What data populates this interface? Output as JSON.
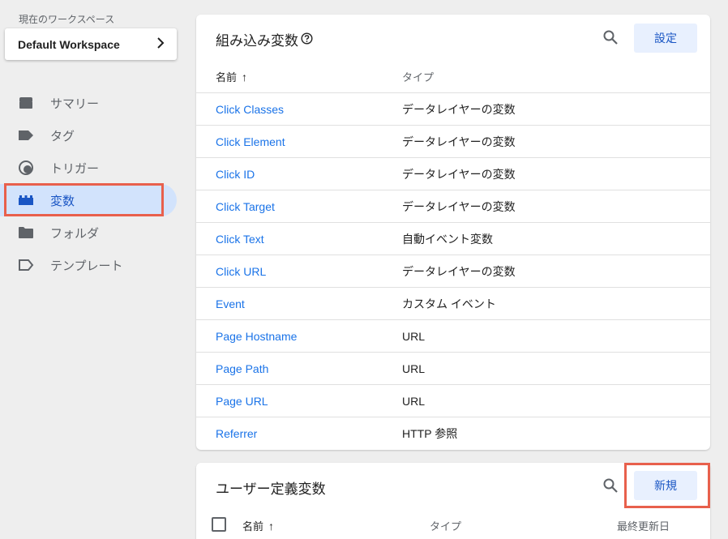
{
  "workspace": {
    "label": "現在のワークスペース",
    "name": "Default Workspace"
  },
  "nav": {
    "items": [
      {
        "label": "サマリー",
        "icon": "summary-icon"
      },
      {
        "label": "タグ",
        "icon": "tag-icon"
      },
      {
        "label": "トリガー",
        "icon": "trigger-icon"
      },
      {
        "label": "変数",
        "icon": "variables-icon",
        "active": true
      },
      {
        "label": "フォルダ",
        "icon": "folder-icon"
      },
      {
        "label": "テンプレート",
        "icon": "template-icon"
      }
    ]
  },
  "builtin": {
    "title": "組み込み変数",
    "configure_label": "設定",
    "columns": {
      "name": "名前",
      "sort": "↑",
      "type": "タイプ"
    },
    "rows": [
      {
        "name": "Click Classes",
        "type": "データレイヤーの変数"
      },
      {
        "name": "Click Element",
        "type": "データレイヤーの変数"
      },
      {
        "name": "Click ID",
        "type": "データレイヤーの変数"
      },
      {
        "name": "Click Target",
        "type": "データレイヤーの変数"
      },
      {
        "name": "Click Text",
        "type": "自動イベント変数"
      },
      {
        "name": "Click URL",
        "type": "データレイヤーの変数"
      },
      {
        "name": "Event",
        "type": "カスタム イベント"
      },
      {
        "name": "Page Hostname",
        "type": "URL"
      },
      {
        "name": "Page Path",
        "type": "URL"
      },
      {
        "name": "Page URL",
        "type": "URL"
      },
      {
        "name": "Referrer",
        "type": "HTTP 参照"
      }
    ]
  },
  "user_defined": {
    "title": "ユーザー定義変数",
    "new_label": "新規",
    "columns": {
      "name": "名前",
      "sort": "↑",
      "type": "タイプ",
      "last_edited": "最終更新日"
    }
  },
  "colors": {
    "link": "#1a73e8",
    "accent": "#1a56c4",
    "highlight": "#e8604c",
    "active_bg": "#d2e3fc"
  }
}
